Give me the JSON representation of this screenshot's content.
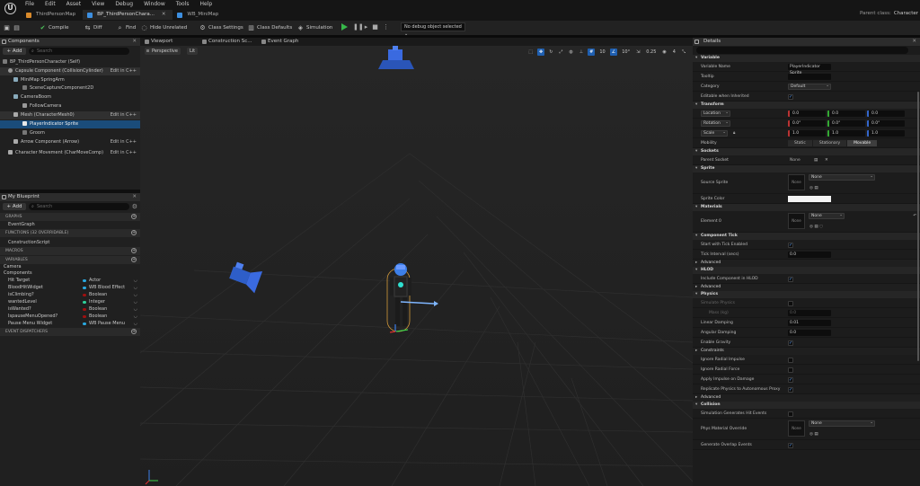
{
  "menubar": {
    "items": [
      "File",
      "Edit",
      "Asset",
      "View",
      "Debug",
      "Window",
      "Tools",
      "Help"
    ],
    "logo": "U"
  },
  "tabs": [
    {
      "label": "ThirdPersonMap",
      "color": "#d98a2b",
      "active": false
    },
    {
      "label": "BP_ThirdPersonChara...",
      "color": "#3d8fe0",
      "active": true
    },
    {
      "label": "WB_MiniMap",
      "color": "#3d8fe0",
      "active": false
    }
  ],
  "parent_class": {
    "label": "Parent class:",
    "value": "Character"
  },
  "toolbar": {
    "compile": "Compile",
    "diff": "Diff",
    "find": "Find",
    "hide_unrelated": "Hide Unrelated",
    "class_settings": "Class Settings",
    "class_defaults": "Class Defaults",
    "simulation": "Simulation",
    "debug_object": "No debug object selected"
  },
  "components": {
    "title": "Components",
    "add": "+ Add",
    "search_placeholder": "Search",
    "items": [
      {
        "label": "BP_ThirdPersonCharacter (Self)",
        "edit": ""
      },
      {
        "label": "Capsule Component (CollisionCylinder)",
        "edit": "Edit in C++"
      },
      {
        "label": "MiniMap SpringArm",
        "edit": ""
      },
      {
        "label": "SceneCaptureComponent2D",
        "edit": ""
      },
      {
        "label": "CameraBoom",
        "edit": ""
      },
      {
        "label": "FollowCamera",
        "edit": ""
      },
      {
        "label": "Mesh (CharacterMesh0)",
        "edit": "Edit in C++"
      },
      {
        "label": "PlayerIndicator Sprite",
        "edit": ""
      },
      {
        "label": "Groom",
        "edit": ""
      },
      {
        "label": "Arrow Component (Arrow)",
        "edit": "Edit in C++"
      },
      {
        "label": "Character Movement (CharMoveComp)",
        "edit": "Edit in C++"
      }
    ]
  },
  "my_blueprint": {
    "title": "My Blueprint",
    "add": "+ Add",
    "search_placeholder": "Search",
    "graphs_header": "GRAPHS",
    "event_graph": "EventGraph",
    "functions_header": "FUNCTIONS",
    "functions_count": "(32 OVERRIDABLE)",
    "construction_script": "ConstructionScript",
    "macros_header": "MACROS",
    "variables_header": "VARIABLES",
    "cat_camera": "Camera",
    "cat_components": "Components",
    "variables": [
      {
        "name": "Hit Target",
        "type": "Actor",
        "color": "#29a8e0"
      },
      {
        "name": "BloodHitWidget",
        "type": "WB Blood Effect",
        "color": "#29a8e0"
      },
      {
        "name": "isClimbing?",
        "type": "Boolean",
        "color": "#a01010"
      },
      {
        "name": "wantedLevel",
        "type": "Integer",
        "color": "#2fd19a"
      },
      {
        "name": "isWanted?",
        "type": "Boolean",
        "color": "#a01010"
      },
      {
        "name": "IspauseMenuOpened?",
        "type": "Boolean",
        "color": "#a01010"
      },
      {
        "name": "Pause Menu Widget",
        "type": "WB Pause Menu",
        "color": "#29a8e0"
      }
    ],
    "event_dispatchers_header": "EVENT DISPATCHERS"
  },
  "viewport": {
    "tabs": [
      "Viewport",
      "Construction Sc...",
      "Event Graph"
    ],
    "perspective": "Perspective",
    "lit": "Lit",
    "grid_snap": "10",
    "rot_snap": "10°",
    "scale_snap": "0.25",
    "cam_speed": "4"
  },
  "details": {
    "title": "Details",
    "variable": {
      "header": "Variable",
      "name_label": "Variable Name",
      "name_value": "PlayerIndicator Sprite",
      "tooltip_label": "Tooltip",
      "category_label": "Category",
      "category_value": "Default",
      "editable_label": "Editable when Inherited"
    },
    "transform": {
      "header": "Transform",
      "location": "Location",
      "rotation": "Rotation",
      "scale": "Scale",
      "loc": [
        "0.0",
        "0.0",
        "0.0"
      ],
      "rot": [
        "0.0°",
        "0.0°",
        "0.0°"
      ],
      "scl": [
        "1.0",
        "1.0",
        "1.0"
      ],
      "mobility_label": "Mobility",
      "mobility_options": [
        "Static",
        "Stationary",
        "Movable"
      ]
    },
    "sockets": {
      "header": "Sockets",
      "parent_label": "Parent Socket",
      "parent_value": "None"
    },
    "sprite": {
      "header": "Sprite",
      "source_label": "Source Sprite",
      "source_value": "None",
      "thumb": "None",
      "color_label": "Sprite Color"
    },
    "materials": {
      "header": "Materials",
      "element_label": "Element 0",
      "element_value": "None",
      "thumb": "None"
    },
    "component_tick": {
      "header": "Component Tick",
      "start_label": "Start with Tick Enabled",
      "interval_label": "Tick Interval (secs)",
      "interval_value": "0.0",
      "advanced": "Advanced"
    },
    "hlod": {
      "header": "HLOD",
      "include_label": "Include Component in HLOD",
      "advanced": "Advanced"
    },
    "physics": {
      "header": "Physics",
      "simulate_label": "Simulate Physics",
      "mass_label": "Mass (kg)",
      "mass_value": "0.0",
      "linear_label": "Linear Damping",
      "linear_value": "0.01",
      "angular_label": "Angular Damping",
      "angular_value": "0.0",
      "gravity_label": "Enable Gravity",
      "constraints": "Constraints",
      "ignore_impulse": "Ignore Radial Impulse",
      "ignore_force": "Ignore Radial Force",
      "apply_impulse": "Apply Impulse on Damage",
      "replicate": "Replicate Physics to Autonomous Proxy",
      "advanced": "Advanced"
    },
    "collision": {
      "header": "Collision",
      "hit_events": "Simulation Generates Hit Events",
      "phys_mat": "Phys Material Override",
      "phys_value": "None",
      "thumb": "None",
      "overlap": "Generate Overlap Events"
    }
  },
  "colors": {
    "accent": "#1f5fb0",
    "selection": "#1a4c7a",
    "play": "#37b84a",
    "character": "#3d7fe8"
  }
}
